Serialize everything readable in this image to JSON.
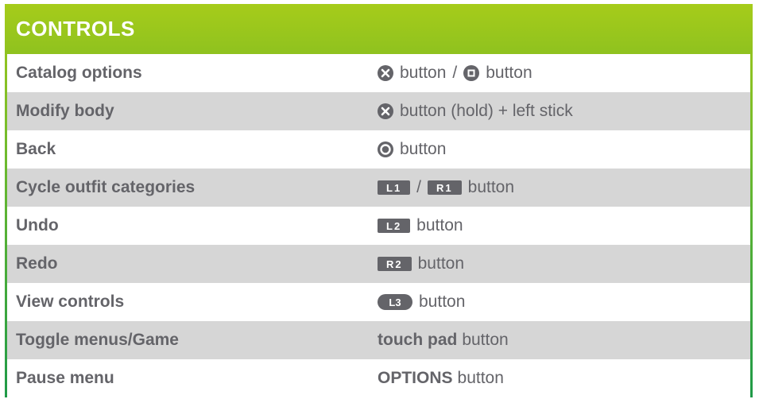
{
  "title": "CONTROLS",
  "colors": {
    "header": "#9ac71d",
    "border_bottom": "#1f9a48",
    "row_alt": "#d6d6d6",
    "text": "#646469"
  },
  "rows": [
    {
      "action": "Catalog options",
      "icons": [
        "cross-button-icon",
        "square-button-icon"
      ],
      "text1": "button",
      "sep": "/",
      "text2": "button"
    },
    {
      "action": "Modify body",
      "icons": [
        "cross-button-icon"
      ],
      "text1": "button (hold) + left stick"
    },
    {
      "action": "Back",
      "icons": [
        "circle-button-icon"
      ],
      "text1": "button"
    },
    {
      "action": "Cycle outfit categories",
      "tag1": "L1",
      "sep": "/",
      "tag2": "R1",
      "text1": "button"
    },
    {
      "action": "Undo",
      "tag1": "L2",
      "text1": "button"
    },
    {
      "action": "Redo",
      "tag1": "R2",
      "text1": "button"
    },
    {
      "action": "View controls",
      "tag1": "L3",
      "text1": "button"
    },
    {
      "action": "Toggle menus/Game",
      "bold": "touch pad",
      "text1": "button"
    },
    {
      "action": "Pause menu",
      "bold": "OPTIONS",
      "text1": "button"
    }
  ]
}
